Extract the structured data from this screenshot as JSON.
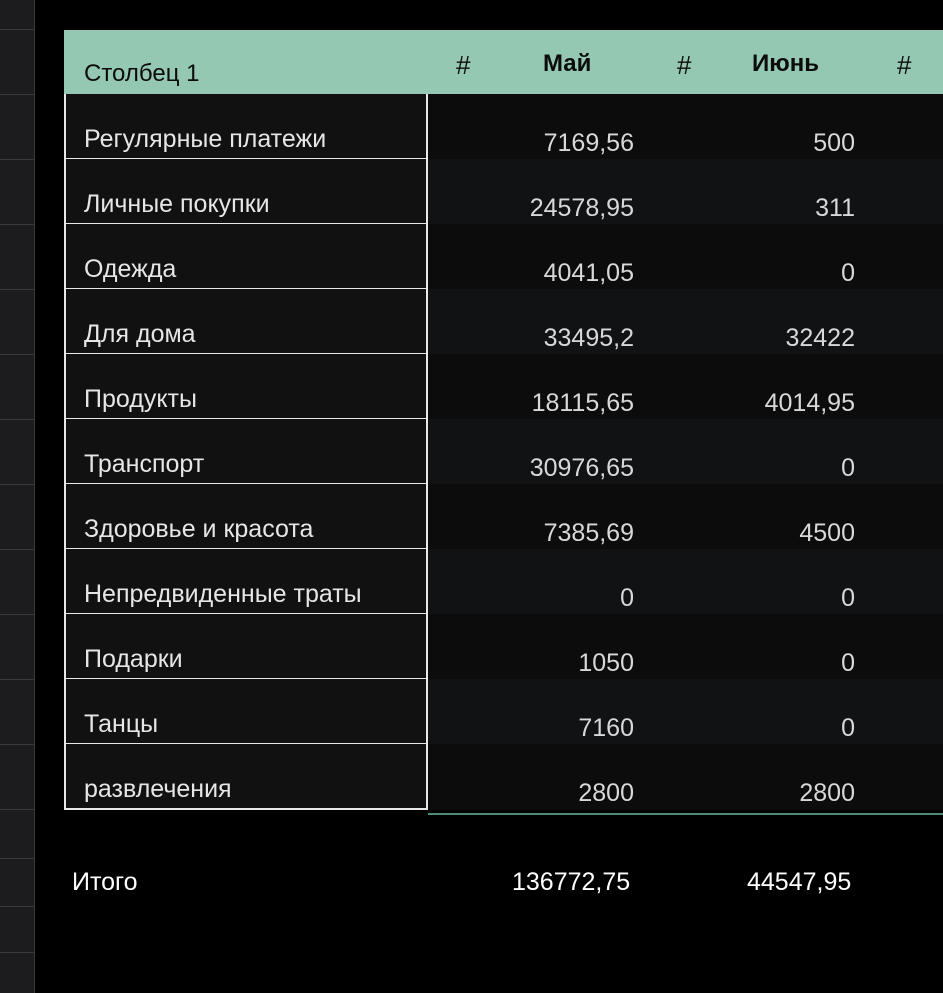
{
  "header": {
    "col1": "Столбец 1",
    "hash": "#",
    "may": "Май",
    "june": "Июнь"
  },
  "rows": [
    {
      "name": "Регулярные платежи",
      "may": "7169,56",
      "june": "500"
    },
    {
      "name": "Личные покупки",
      "may": "24578,95",
      "june": "311"
    },
    {
      "name": "Одежда",
      "may": "4041,05",
      "june": "0"
    },
    {
      "name": "Для дома",
      "may": "33495,2",
      "june": "32422"
    },
    {
      "name": "Продукты",
      "may": "18115,65",
      "june": "4014,95"
    },
    {
      "name": "Транспорт",
      "may": "30976,65",
      "june": "0"
    },
    {
      "name": "Здоровье и красота",
      "may": "7385,69",
      "june": "4500"
    },
    {
      "name": "Непредвиденные траты",
      "may": "0",
      "june": "0"
    },
    {
      "name": "Подарки",
      "may": "1050",
      "june": "0"
    },
    {
      "name": "Танцы",
      "may": "7160",
      "june": "0"
    },
    {
      "name": "развлечения",
      "may": "2800",
      "june": "2800"
    }
  ],
  "totals": {
    "label": "Итого",
    "may": "136772,75",
    "june": "44547,95"
  },
  "colors": {
    "header_bg": "#94c8b2",
    "background": "#000000"
  }
}
